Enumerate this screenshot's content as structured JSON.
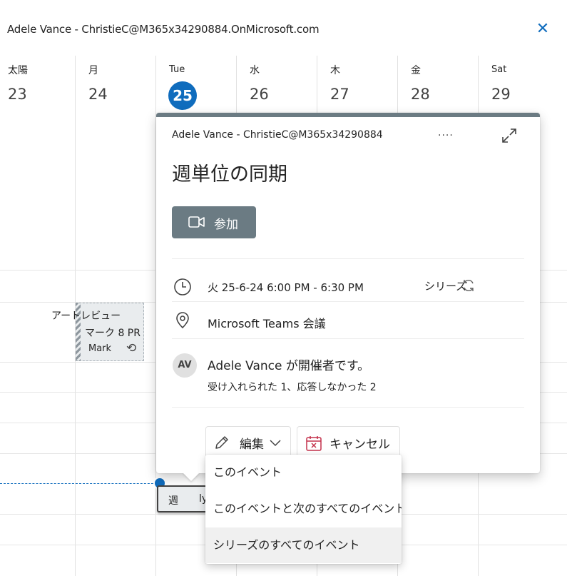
{
  "header": {
    "title": "Adele Vance - ChristieC@M365x34290884.OnMicrosoft.com",
    "close_glyph": "✕"
  },
  "week": [
    {
      "name": "太陽",
      "num": "23",
      "today": false
    },
    {
      "name": "月",
      "num": "24",
      "today": false
    },
    {
      "name": "Tue",
      "num": "25",
      "today": true
    },
    {
      "name": "水",
      "num": "26",
      "today": false
    },
    {
      "name": "木",
      "num": "27",
      "today": false
    },
    {
      "name": "金",
      "num": "28",
      "today": false
    },
    {
      "name": "Sat",
      "num": "29",
      "today": false
    }
  ],
  "events": {
    "art_review": {
      "line1": "アートレビュー",
      "line2": "マーク 8 PR",
      "line3": "Mark"
    },
    "weekly": {
      "part1": "週",
      "part2": "ly"
    }
  },
  "popup": {
    "organizer_header": "Adele Vance - ChristieC@M365x34290884",
    "more": "....",
    "title": "週単位の同期",
    "join_label": "参加",
    "datetime": "火 25-6-24  6:00 PM - 6:30 PM",
    "series_label": "シリーズ",
    "location": "Microsoft Teams 会議",
    "avatar_initials": "AV",
    "organizer_text": "Adele Vance が開催者です。",
    "responses": "受け入れられた 1、応答しなかった 2",
    "edit_label": "編集",
    "cancel_label": "キャンセル"
  },
  "edit_menu": {
    "items": [
      "このイベント",
      "このイベントと次のすべてのイベント",
      "シリーズのすべてのイベント"
    ],
    "hovered_index": 2
  },
  "colors": {
    "accent": "#0f6cbd",
    "popup_band": "#6b7b83",
    "cancel_icon": "#c4314b"
  },
  "icons": {
    "close": "close-icon",
    "expand": "expand-icon",
    "camera": "video-camera-icon",
    "clock": "clock-icon",
    "location": "location-pin-icon",
    "series": "repeat-icon",
    "edit": "pencil-icon",
    "chevron": "chevron-down-icon",
    "cancel": "calendar-cancel-icon"
  }
}
